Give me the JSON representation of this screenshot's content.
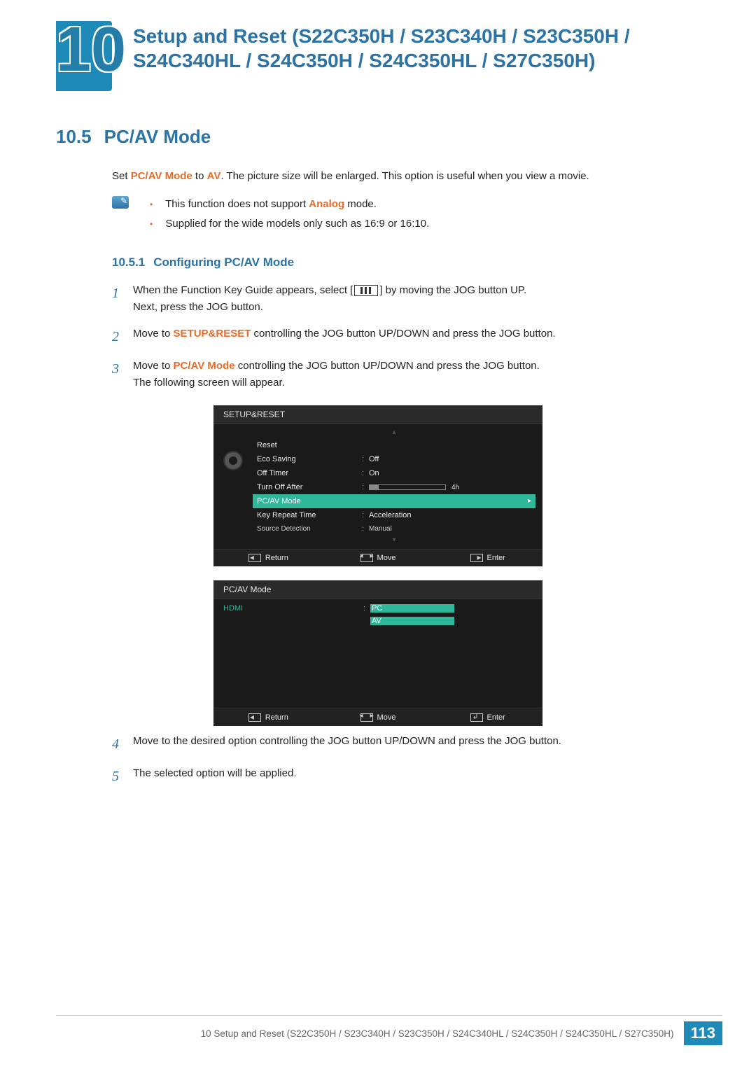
{
  "chapter": {
    "number": "10",
    "title": "Setup and Reset (S22C350H / S23C340H / S23C350H / S24C340HL / S24C350H / S24C350HL / S27C350H)"
  },
  "section": {
    "number": "10.5",
    "title": "PC/AV Mode"
  },
  "intro": {
    "pre": "Set ",
    "hl1": "PC/AV Mode",
    "mid": " to ",
    "hl2": "AV",
    "post": ". The picture size will be enlarged. This option is useful when you view a movie."
  },
  "notes": {
    "item1_pre": "This function does not support ",
    "item1_hl": "Analog",
    "item1_post": " mode.",
    "item2": "Supplied for the wide models only such as 16:9 or 16:10."
  },
  "subsection": {
    "number": "10.5.1",
    "title": "Configuring PC/AV Mode"
  },
  "steps": {
    "s1a": "When the Function Key Guide appears, select [",
    "s1b": "] by moving the JOG button UP.",
    "s1c": "Next, press the JOG button.",
    "s2a": "Move to ",
    "s2hl": "SETUP&RESET",
    "s2b": " controlling the JOG button UP/DOWN and press the JOG button.",
    "s3a": "Move to ",
    "s3hl": "PC/AV Mode",
    "s3b": " controlling the JOG button UP/DOWN and press the JOG button.",
    "s3c": "The following screen will appear.",
    "s4": "Move to the desired option controlling the JOG button UP/DOWN and press the JOG button.",
    "s5": "The selected option will be applied."
  },
  "osd1": {
    "title": "SETUP&RESET",
    "rows": {
      "reset": "Reset",
      "eco": "Eco Saving",
      "eco_v": "Off",
      "offt": "Off Timer",
      "offt_v": "On",
      "toa": "Turn Off After",
      "toa_v": "4h",
      "pcav": "PC/AV Mode",
      "krt": "Key Repeat Time",
      "krt_v": "Acceleration",
      "srcd": "Source Detection",
      "srcd_v": "Manual"
    },
    "footer": {
      "return": "Return",
      "move": "Move",
      "enter": "Enter"
    }
  },
  "osd2": {
    "title": "PC/AV Mode",
    "hdmi": "HDMI",
    "pc": "PC",
    "av": "AV",
    "footer": {
      "return": "Return",
      "move": "Move",
      "enter": "Enter"
    }
  },
  "footer": {
    "text": "10 Setup and Reset (S22C350H / S23C340H / S23C350H / S24C340HL / S24C350H / S24C350HL / S27C350H)",
    "page": "113"
  }
}
